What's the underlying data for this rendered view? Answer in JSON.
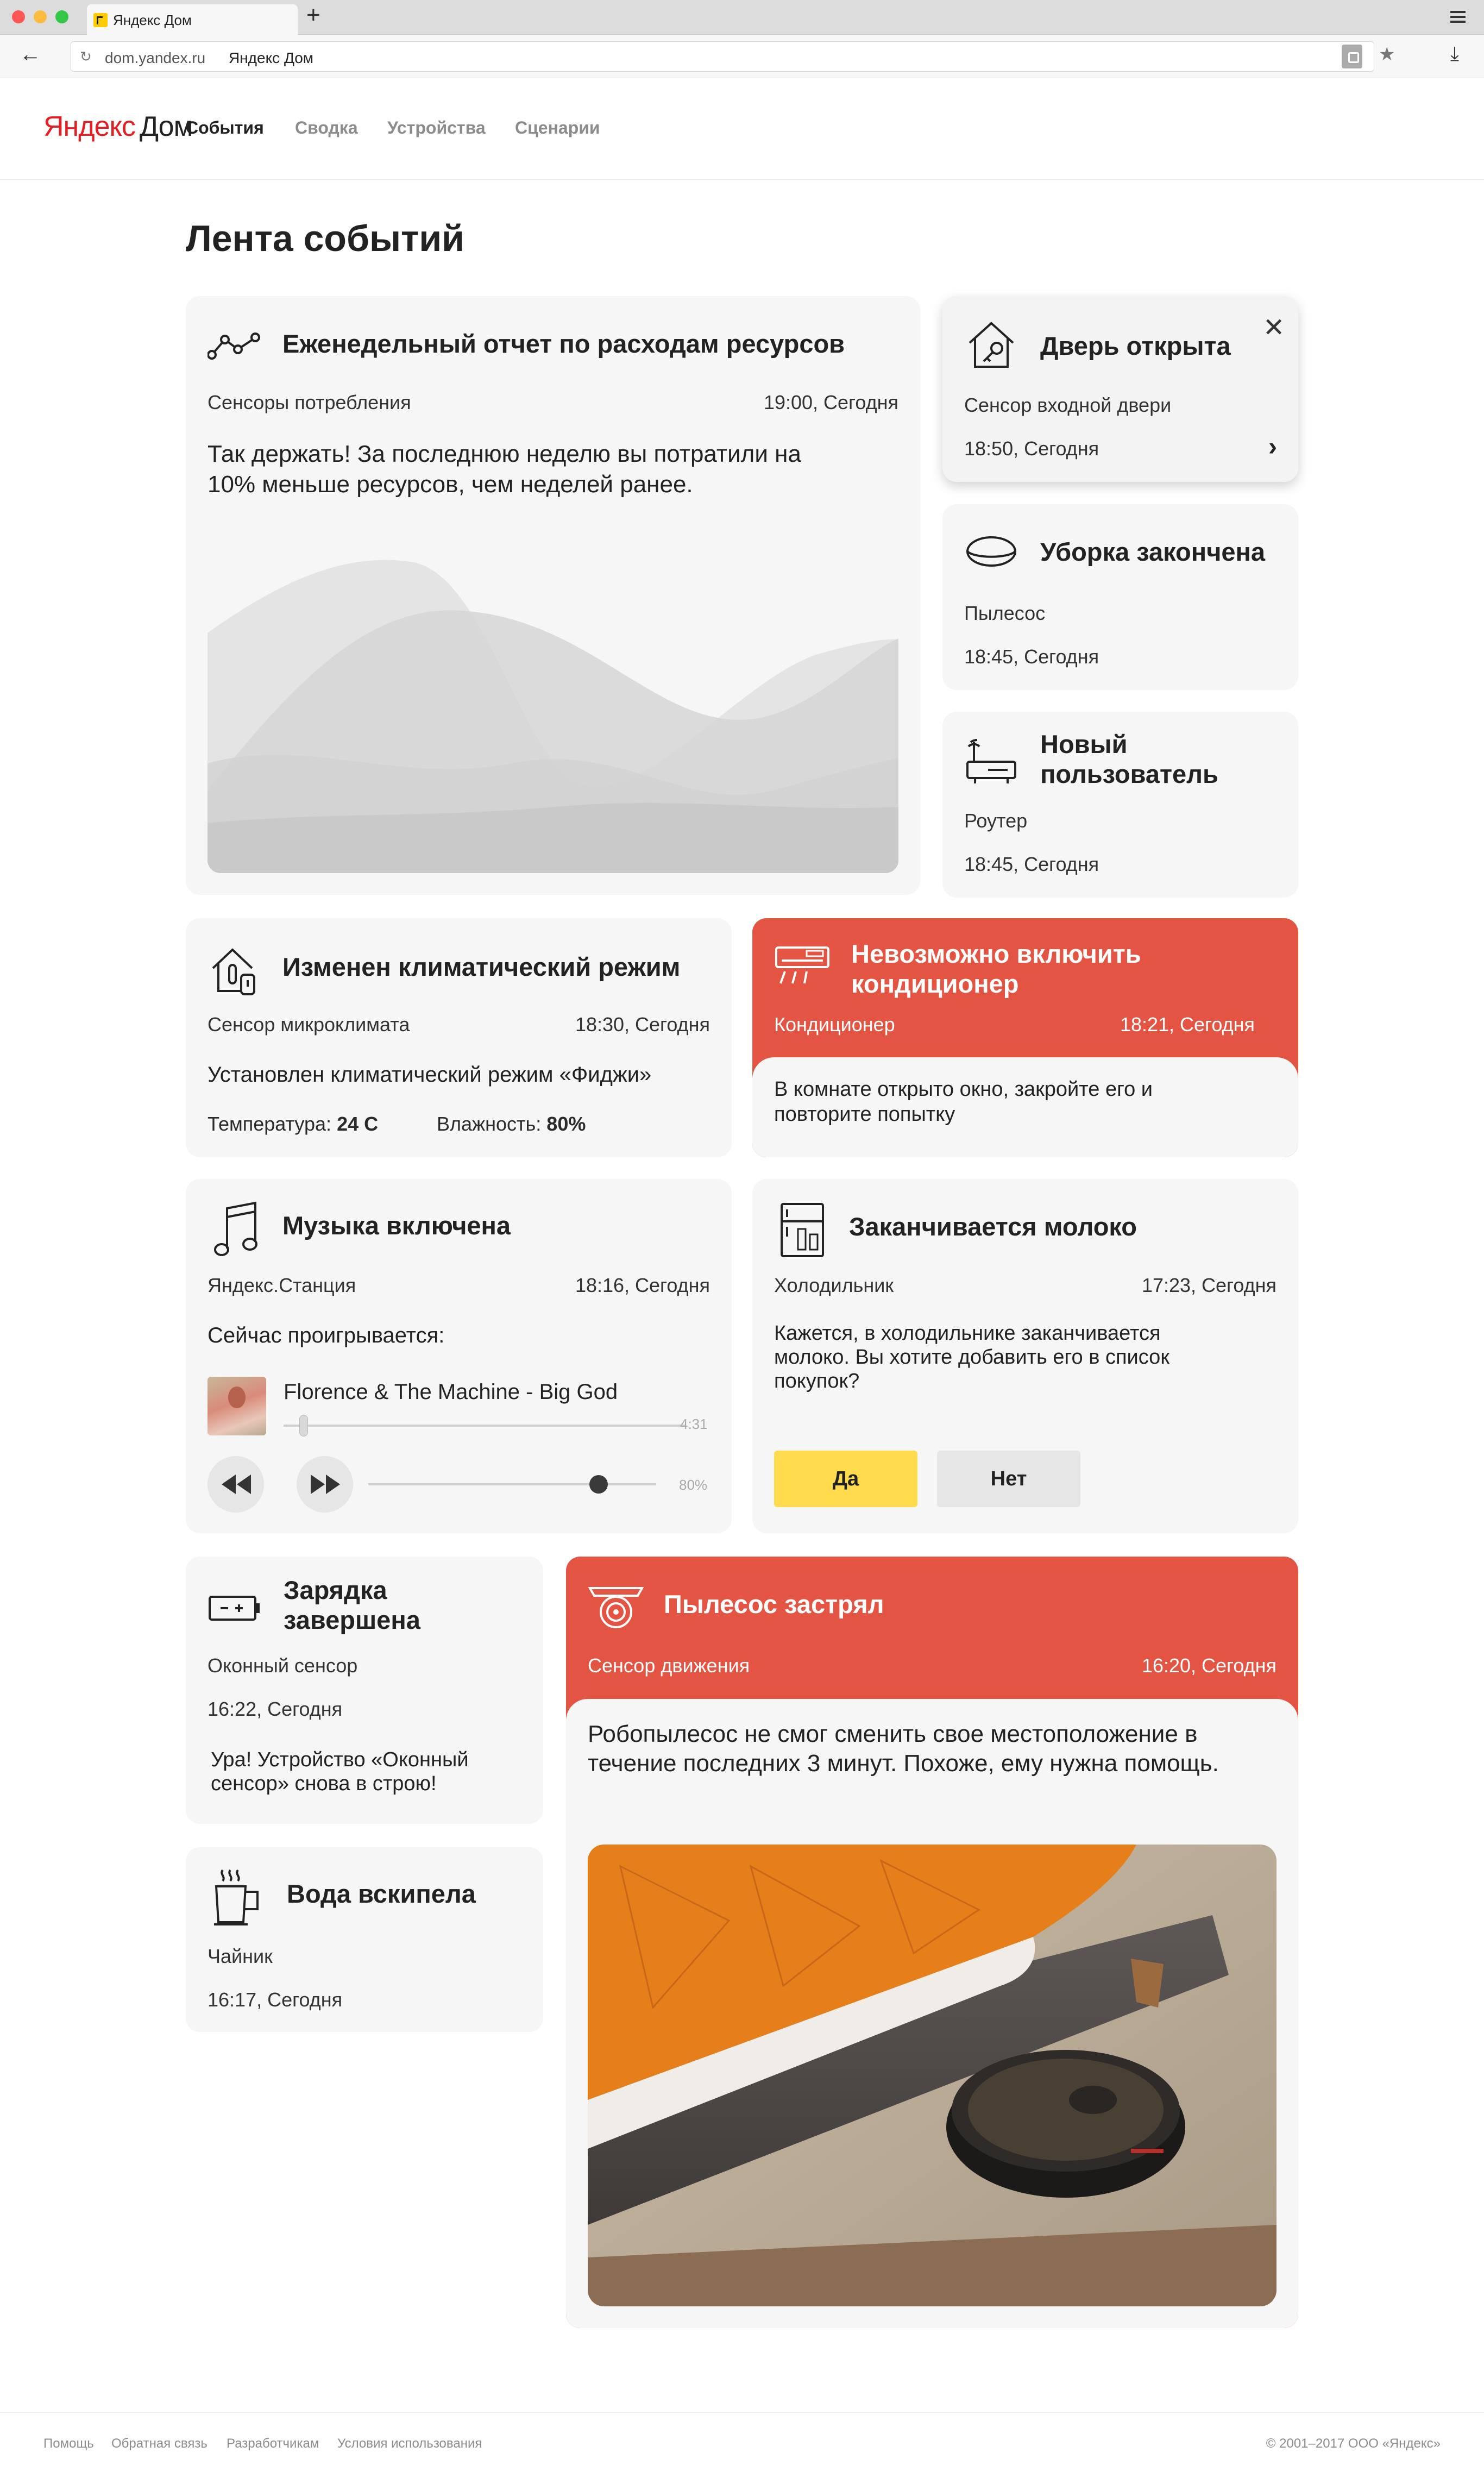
{
  "browser": {
    "tab_title": "Яндекс Дом",
    "url_host": "dom.yandex.ru",
    "url_title": "Яндекс Дом"
  },
  "site": {
    "logo_yandex": "Яндекс",
    "logo_dom": "Дом",
    "nav": [
      "События",
      "Сводка",
      "Устройства",
      "Сценарии"
    ],
    "active_nav": "События"
  },
  "page_title": "Лента событий",
  "cards": {
    "report": {
      "title": "Еженедельный отчет по расходам ресурсов",
      "source": "Сенсоры потребления",
      "time": "19:00, Сегодня",
      "text": "Так держать! За последнюю неделю вы потратили на 10% меньше ресурсов, чем неделей ранее."
    },
    "door": {
      "title": "Дверь открыта",
      "source": "Сенсор входной двери",
      "time": "18:50, Сегодня"
    },
    "cleaning": {
      "title": "Уборка закончена",
      "source": "Пылесос",
      "time": "18:45, Сегодня"
    },
    "new_user": {
      "title": "Новый пользователь",
      "source": "Роутер",
      "time": "18:45, Сегодня"
    },
    "climate": {
      "title": "Изменен климатический режим",
      "source": "Сенсор микроклимата",
      "time": "18:30, Сегодня",
      "text": "Установлен климатический режим «Фиджи»",
      "temp_label": "Температура:",
      "temp_value": "24 С",
      "hum_label": "Влажность:",
      "hum_value": "80%"
    },
    "ac": {
      "title": "Невозможно включить кондиционер",
      "source": "Кондиционер",
      "time": "18:21, Сегодня",
      "text": "В комнате открыто окно, закройте его и повторите попытку"
    },
    "music": {
      "title": "Музыка включена",
      "source": "Яндекс.Станция",
      "time": "18:16, Сегодня",
      "now_playing": "Сейчас проигрывается:",
      "track": "Florence & The Machine - Big God",
      "duration": "4:31",
      "progress": 0.05,
      "volume": 0.8,
      "volume_label": "80%"
    },
    "milk": {
      "title": "Заканчивается молоко",
      "source": "Холодильник",
      "time": "17:23, Сегодня",
      "text": "Кажется, в холодильнике заканчивается молоко. Вы хотите добавить его в список покупок?",
      "yes": "Да",
      "no": "Нет"
    },
    "charge": {
      "title": "Зарядка завершена",
      "source": "Оконный сенсор",
      "time": "16:22, Сегодня",
      "text": "Ура! Устройство «Оконный сенсор» снова в строю!"
    },
    "vacuum_stuck": {
      "title": "Пылесос застрял",
      "source": "Сенсор движения",
      "time": "16:20, Сегодня",
      "text": "Робопылесос не смог сменить свое местоположение в течение последних 3 минут. Похоже, ему нужна помощь."
    },
    "kettle": {
      "title": "Вода вскипела",
      "source": "Чайник",
      "time": "16:17, Сегодня"
    }
  },
  "footer": {
    "links": [
      "Помощь",
      "Обратная связь",
      "Разработчикам",
      "Условия использования"
    ],
    "copyright": "© 2001–2017 ООО «Яндекс»"
  },
  "colors": {
    "accent_red": "#e35442",
    "yellow_button": "#ffdb4d",
    "card_bg": "#f6f6f6"
  }
}
